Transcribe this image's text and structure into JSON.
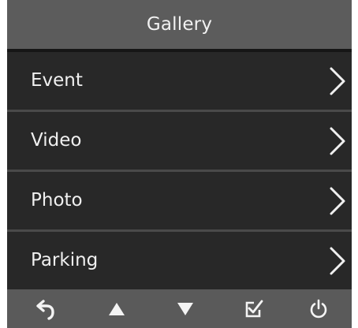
{
  "header": {
    "title": "Gallery"
  },
  "menu": {
    "items": [
      {
        "label": "Event",
        "icon": "chevron-right-icon"
      },
      {
        "label": "Video",
        "icon": "chevron-right-icon"
      },
      {
        "label": "Photo",
        "icon": "chevron-right-icon"
      },
      {
        "label": "Parking",
        "icon": "chevron-right-icon"
      }
    ]
  },
  "footer": {
    "buttons": [
      {
        "icon": "back-icon"
      },
      {
        "icon": "up-arrow-icon"
      },
      {
        "icon": "down-arrow-icon"
      },
      {
        "icon": "confirm-checkbox-icon"
      },
      {
        "icon": "power-icon"
      }
    ]
  },
  "colors": {
    "header_bg": "#5c5c5c",
    "row_bg": "#282828",
    "separator": "#4a4a4a",
    "footer_bg": "#5a5a5a",
    "text": "#f0f0f0"
  }
}
